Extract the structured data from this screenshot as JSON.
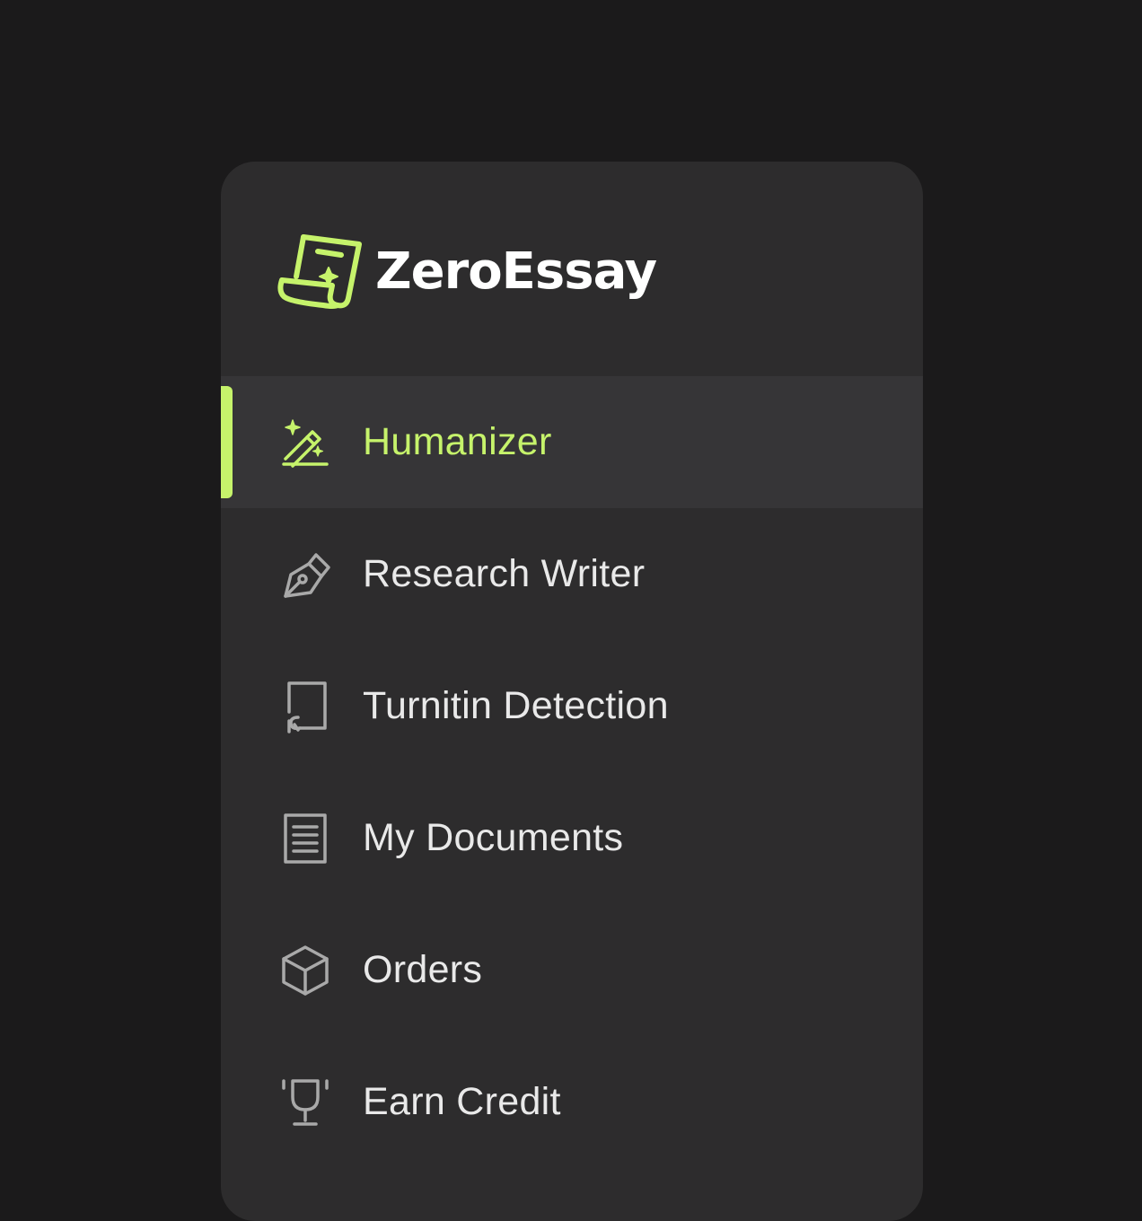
{
  "brand": {
    "name": "ZeroEssay",
    "logo_icon": "scroll-sparkle-icon"
  },
  "colors": {
    "page_background": "#1b1a1b",
    "sidebar_background": "#2d2c2d",
    "active_background": "#363537",
    "accent": "#c6f36b",
    "icon_inactive": "#a9a9a9",
    "text": "#e9e9e9"
  },
  "nav": {
    "items": [
      {
        "label": "Humanizer",
        "icon": "magic-wand-icon",
        "active": true
      },
      {
        "label": "Research Writer",
        "icon": "pen-nib-icon",
        "active": false
      },
      {
        "label": "Turnitin Detection",
        "icon": "page-curl-icon",
        "active": false
      },
      {
        "label": "My Documents",
        "icon": "document-icon",
        "active": false
      },
      {
        "label": "Orders",
        "icon": "box-icon",
        "active": false
      },
      {
        "label": "Earn Credit",
        "icon": "trophy-icon",
        "active": false
      }
    ]
  }
}
